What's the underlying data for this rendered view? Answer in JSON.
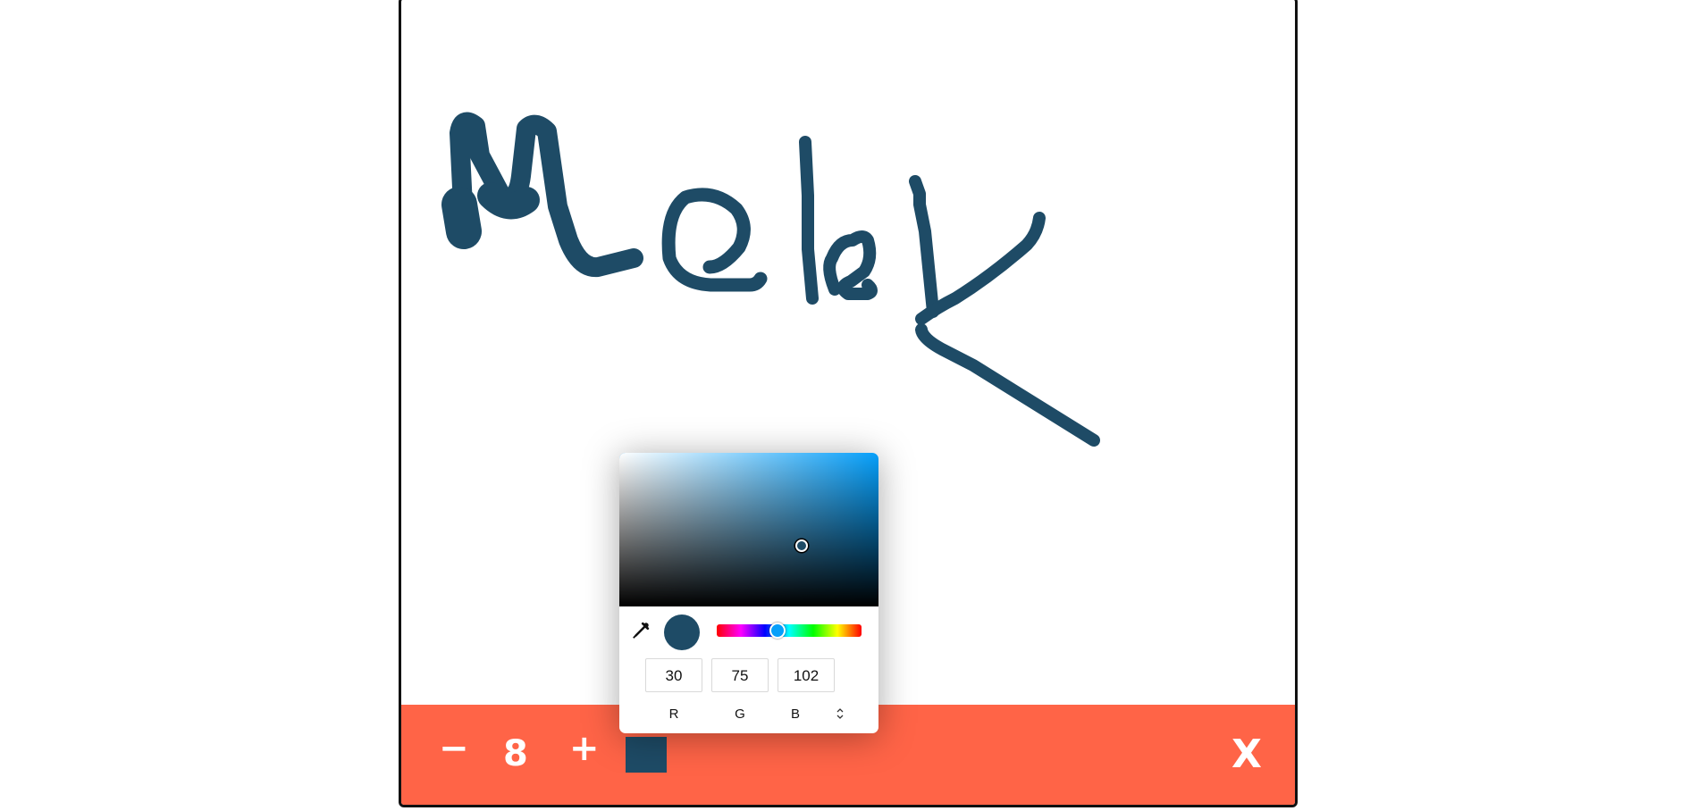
{
  "canvas": {
    "drawing_text": "Melek",
    "stroke_color": "#1e4b66"
  },
  "toolbar": {
    "background": "#ff6447",
    "minus_label": "−",
    "brush_size": "8",
    "plus_label": "+",
    "color_swatch": "#1e4b66",
    "close_label": "X"
  },
  "picker": {
    "hue_color": "#069ffa",
    "selected_color": "#1e4b66",
    "channels": [
      {
        "label": "R",
        "value": "30"
      },
      {
        "label": "G",
        "value": "75"
      },
      {
        "label": "B",
        "value": "102"
      }
    ],
    "icons": [
      "eyedropper-icon",
      "mode-toggle-icon"
    ]
  }
}
